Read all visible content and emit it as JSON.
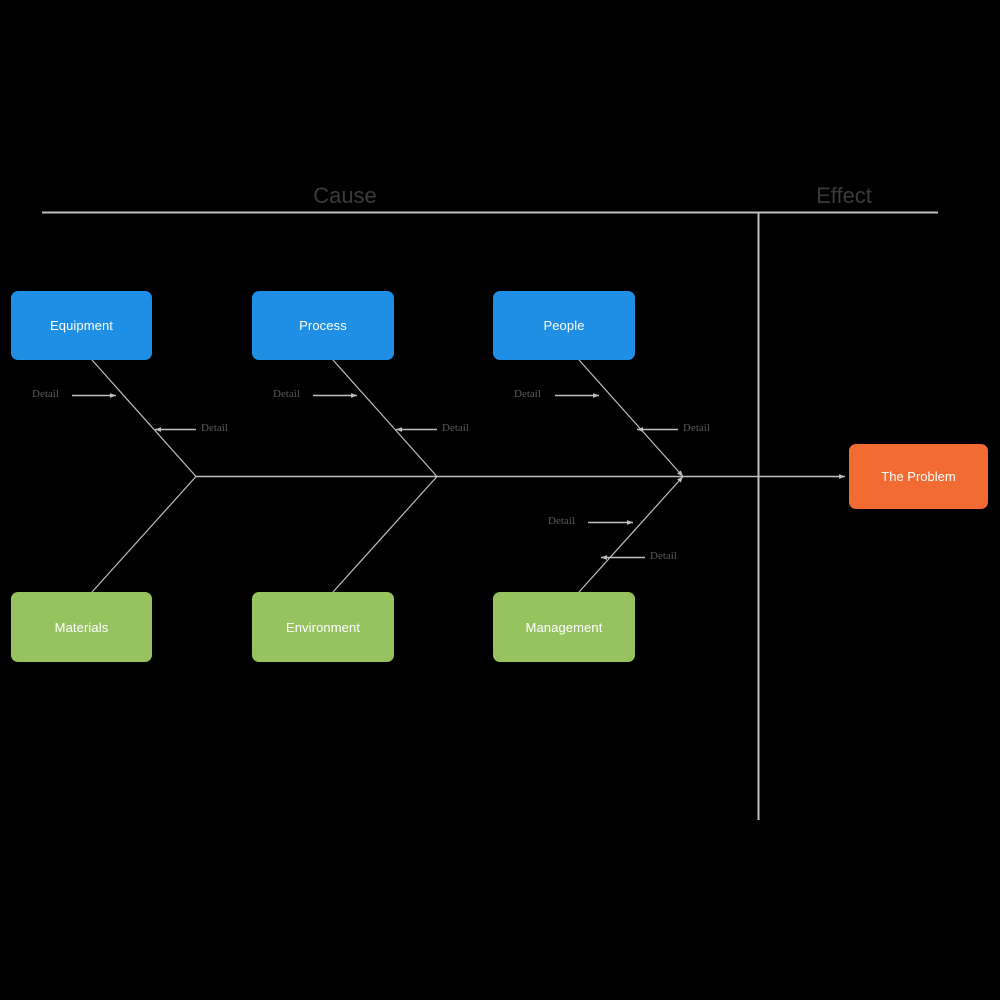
{
  "diagram": {
    "type": "fishbone-ishikawa",
    "background_color": "#000000",
    "headers": {
      "cause": "Cause",
      "effect": "Effect"
    },
    "effect": {
      "label": "The Problem",
      "color": "#F26B33"
    },
    "category_color_top": "#1E8FE4",
    "category_color_bottom": "#96C35F",
    "bone_color": "#BFBFBF",
    "categories_top": [
      {
        "label": "Equipment"
      },
      {
        "label": "Process"
      },
      {
        "label": "People"
      }
    ],
    "categories_bottom": [
      {
        "label": "Materials"
      },
      {
        "label": "Environment"
      },
      {
        "label": "Management"
      }
    ],
    "details": [
      {
        "label": "Detail"
      },
      {
        "label": "Detail"
      },
      {
        "label": "Detail"
      },
      {
        "label": "Detail"
      },
      {
        "label": "Detail"
      },
      {
        "label": "Detail"
      },
      {
        "label": "Detail"
      },
      {
        "label": "Detail"
      }
    ]
  }
}
